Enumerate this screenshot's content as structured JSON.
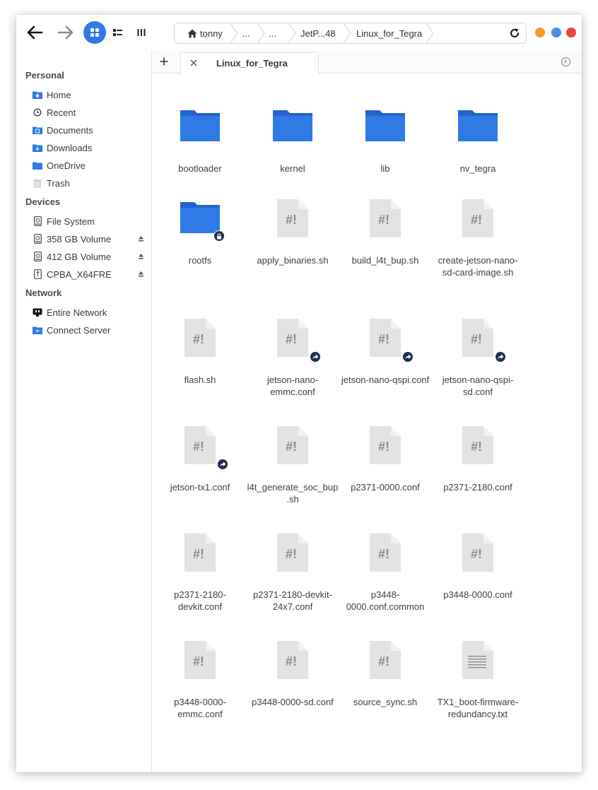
{
  "toolbar": {
    "breadcrumbs": [
      "tonny",
      "...",
      "...",
      "JetP...48",
      "Linux_for_Tegra"
    ]
  },
  "colors": {
    "accent": "#2f7ae5",
    "folder": "#2f7ae5",
    "folder_dark": "#2563cc",
    "window_min": "#f89a2a",
    "window_max": "#4a90e2",
    "window_close": "#e84545",
    "emblem": "#1d2d4f"
  },
  "sidebar": {
    "sections": [
      {
        "title": "Personal",
        "items": [
          {
            "label": "Home",
            "icon": "home-folder-icon"
          },
          {
            "label": "Recent",
            "icon": "clock-icon"
          },
          {
            "label": "Documents",
            "icon": "documents-folder-icon"
          },
          {
            "label": "Downloads",
            "icon": "downloads-folder-icon"
          },
          {
            "label": "OneDrive",
            "icon": "folder-icon"
          },
          {
            "label": "Trash",
            "icon": "trash-icon"
          }
        ]
      },
      {
        "title": "Devices",
        "items": [
          {
            "label": "File System",
            "icon": "drive-icon"
          },
          {
            "label": "358 GB Volume",
            "icon": "drive-icon",
            "eject": true
          },
          {
            "label": "412 GB Volume",
            "icon": "drive-icon",
            "eject": true
          },
          {
            "label": "CPBA_X64FRE",
            "icon": "usb-drive-icon",
            "eject": true
          }
        ]
      },
      {
        "title": "Network",
        "items": [
          {
            "label": "Entire Network",
            "icon": "network-icon"
          },
          {
            "label": "Connect Server",
            "icon": "server-folder-icon"
          }
        ]
      }
    ]
  },
  "tabs": {
    "active_label": "Linux_for_Tegra"
  },
  "files": [
    {
      "name": "bootloader",
      "type": "folder"
    },
    {
      "name": "kernel",
      "type": "folder"
    },
    {
      "name": "lib",
      "type": "folder"
    },
    {
      "name": "nv_tegra",
      "type": "folder"
    },
    {
      "name": "rootfs",
      "type": "folder",
      "emblem": "lock"
    },
    {
      "name": "apply_binaries.sh",
      "type": "script"
    },
    {
      "name": "build_l4t_bup.sh",
      "type": "script"
    },
    {
      "name": "create-jetson-nano-sd-card-image.sh",
      "type": "script"
    },
    {
      "name": "flash.sh",
      "type": "script"
    },
    {
      "name": "jetson-nano-emmc.conf",
      "type": "script",
      "emblem": "link"
    },
    {
      "name": "jetson-nano-qspi.conf",
      "type": "script",
      "emblem": "link"
    },
    {
      "name": "jetson-nano-qspi-sd.conf",
      "type": "script",
      "emblem": "link"
    },
    {
      "name": "jetson-tx1.conf",
      "type": "script",
      "emblem": "link"
    },
    {
      "name": "l4t_generate_soc_bup.sh",
      "type": "script"
    },
    {
      "name": "p2371-0000.conf",
      "type": "script"
    },
    {
      "name": "p2371-2180.conf",
      "type": "script"
    },
    {
      "name": "p2371-2180-devkit.conf",
      "type": "script"
    },
    {
      "name": "p2371-2180-devkit-24x7.conf",
      "type": "script"
    },
    {
      "name": "p3448-0000.conf.common",
      "type": "script"
    },
    {
      "name": "p3448-0000.conf",
      "type": "script"
    },
    {
      "name": "p3448-0000-emmc.conf",
      "type": "script"
    },
    {
      "name": "p3448-0000-sd.conf",
      "type": "script"
    },
    {
      "name": "source_sync.sh",
      "type": "script"
    },
    {
      "name": "TX1_boot-firmware-redundancy.txt",
      "type": "text"
    }
  ]
}
